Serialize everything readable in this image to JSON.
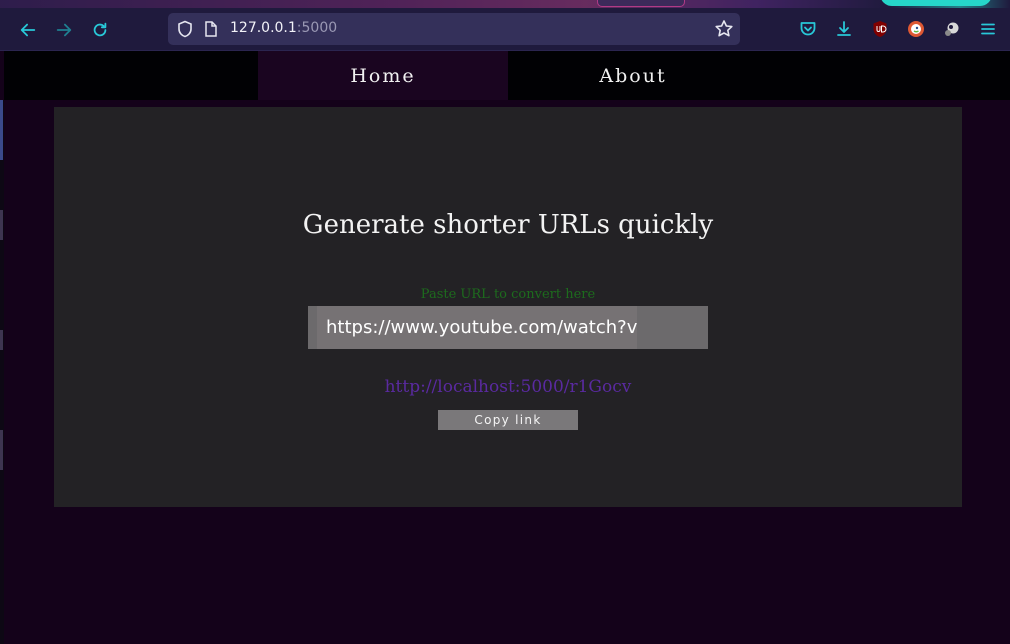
{
  "browser": {
    "url_host": "127.0.0.1",
    "url_port": ":5000",
    "icons": [
      "back-icon",
      "forward-icon",
      "reload-icon",
      "shield-icon",
      "page-icon",
      "bookmark-star-icon",
      "pocket-icon",
      "download-icon",
      "ublock-icon",
      "duckduckgo-icon",
      "extension-icon",
      "menu-icon"
    ]
  },
  "nav": {
    "home_label": "Home",
    "about_label": "About"
  },
  "main": {
    "headline": "Generate shorter URLs quickly",
    "input_hint": "Paste URL to convert here",
    "input_value": "https://www.youtube.com/watch?v=",
    "short_link": "http://localhost:5000/r1Gocv",
    "copy_button_label": "Copy link"
  },
  "colors": {
    "page_bg": "#14021a",
    "card_bg": "#232225",
    "hint_green": "#1d6b1d",
    "link_purple": "#5a2aa0",
    "accent_teal": "#28c8d8"
  }
}
